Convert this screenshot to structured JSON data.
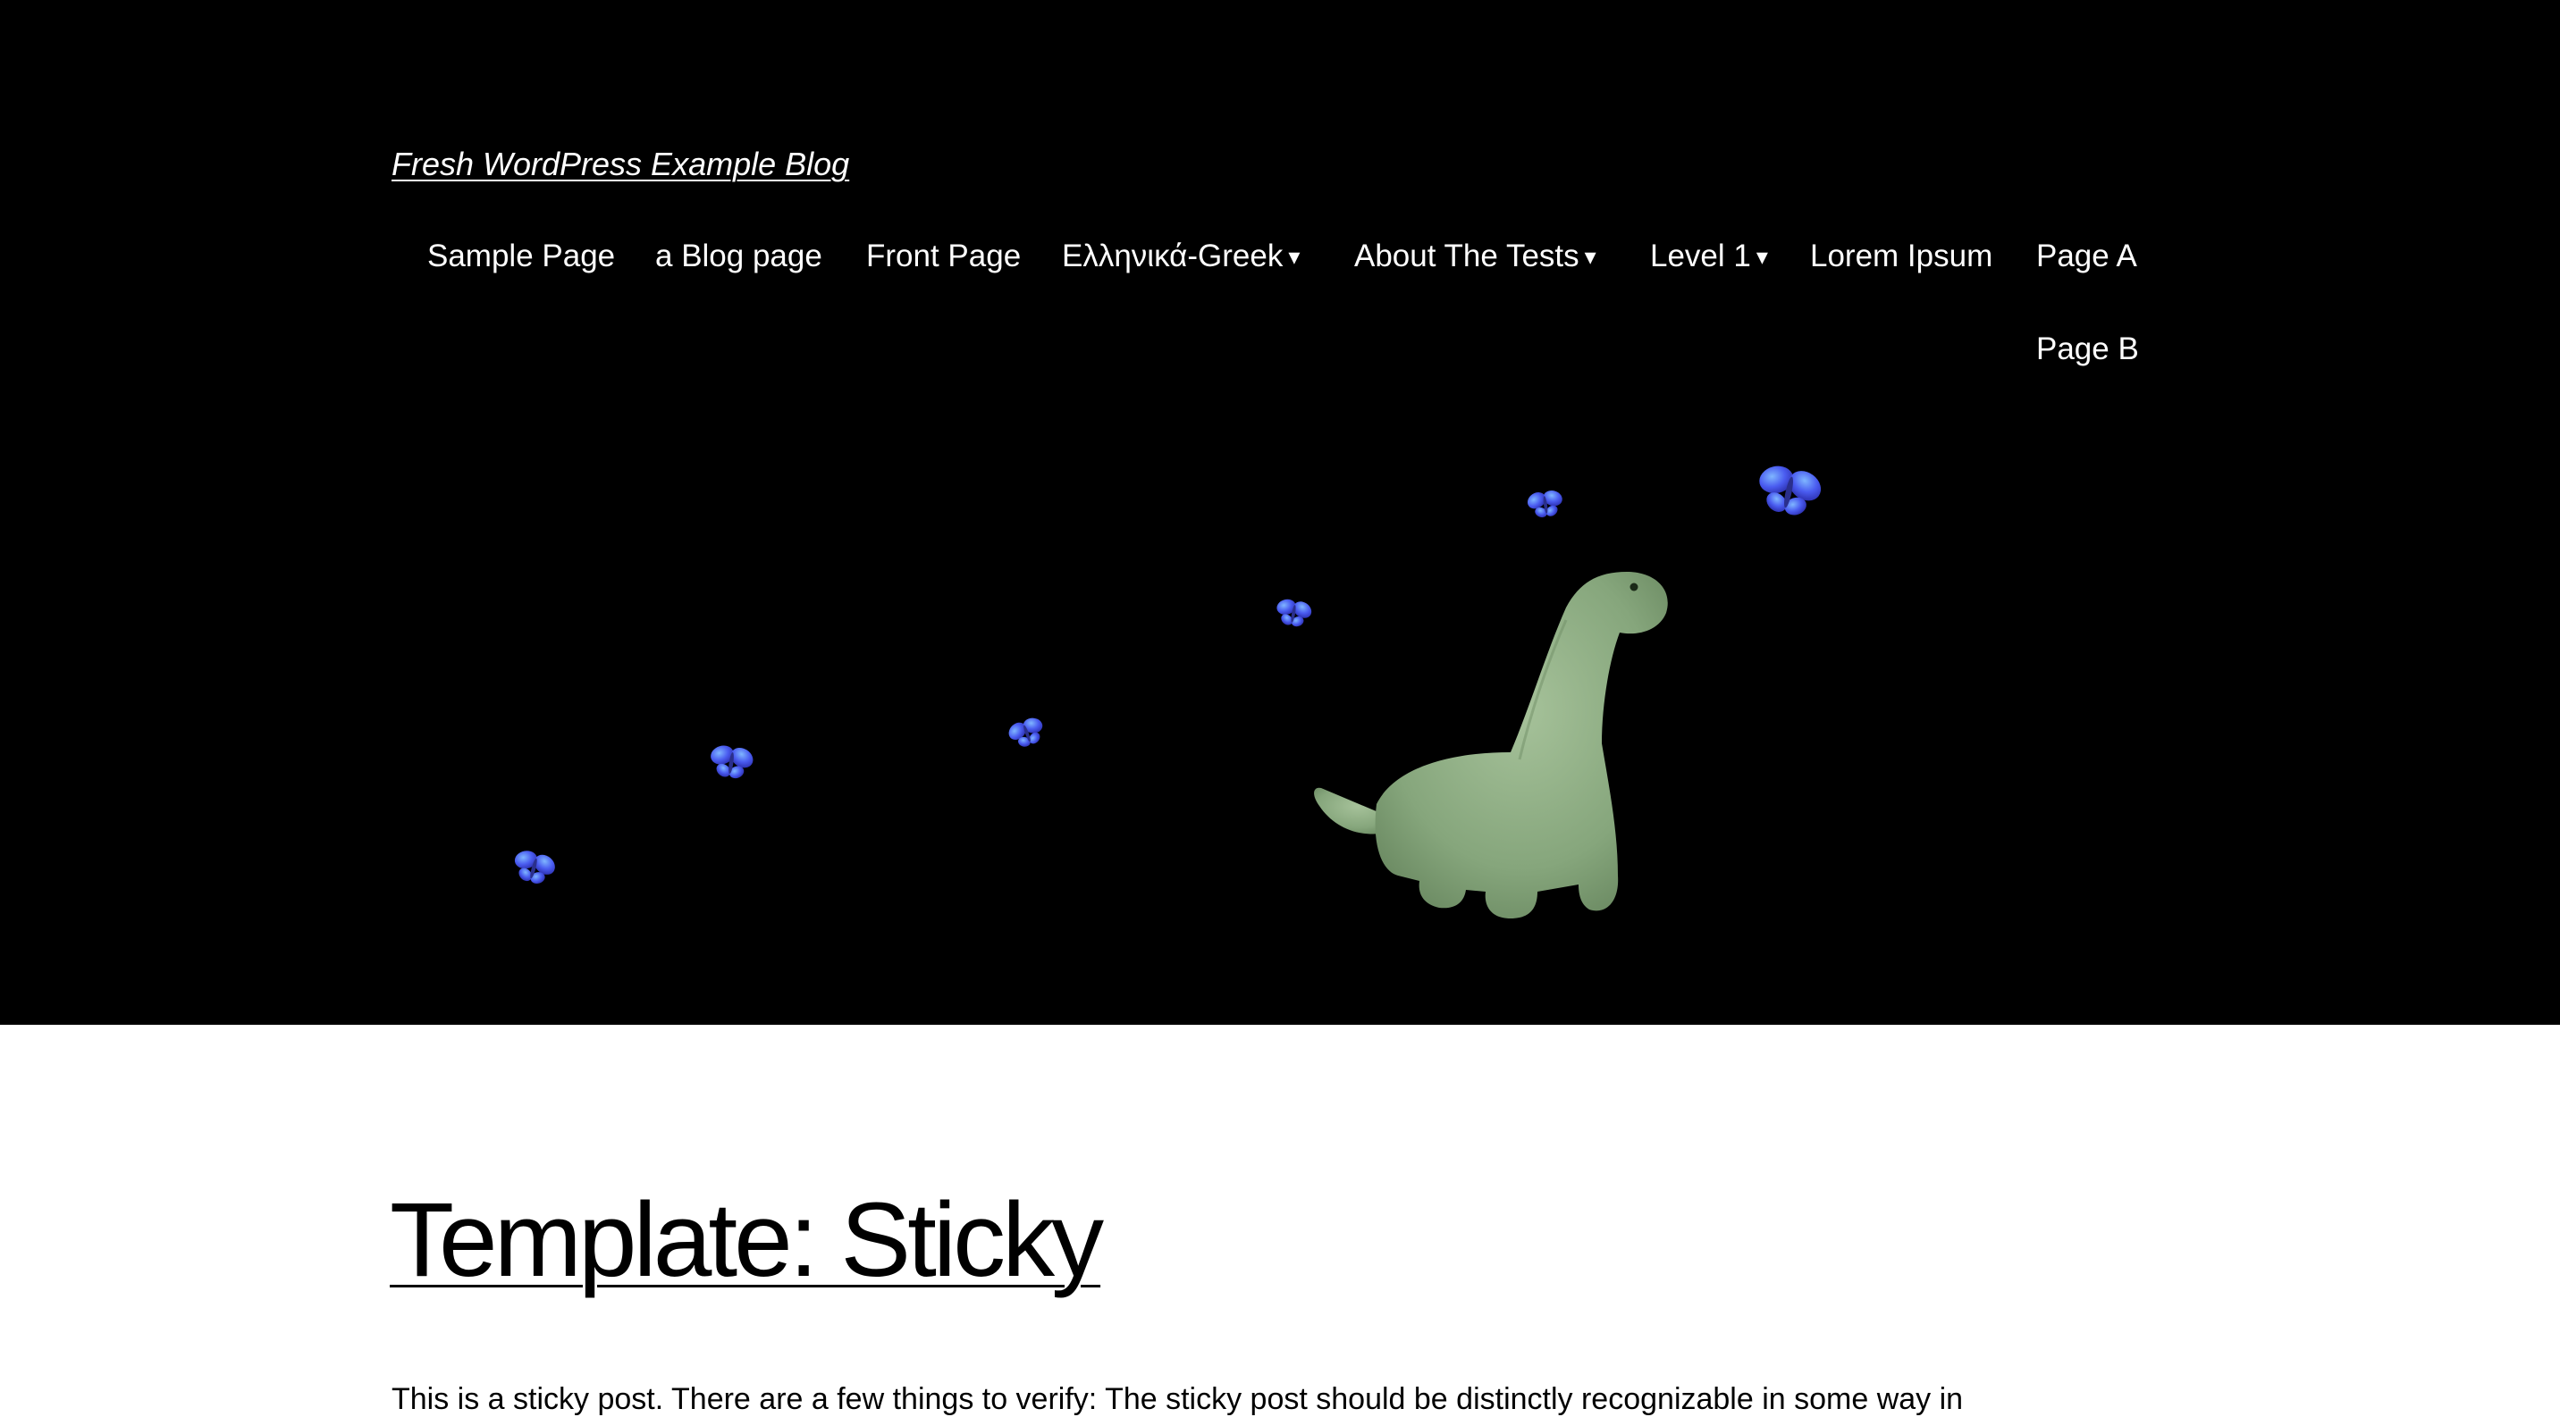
{
  "site": {
    "title": "Fresh WordPress Example Blog"
  },
  "nav": {
    "items": [
      {
        "label": "Sample Page",
        "has_submenu": false
      },
      {
        "label": "a Blog page",
        "has_submenu": false
      },
      {
        "label": "Front Page",
        "has_submenu": false
      },
      {
        "label": "Ελληνικά-Greek",
        "has_submenu": true
      },
      {
        "label": "About The Tests",
        "has_submenu": true
      },
      {
        "label": "Level 1",
        "has_submenu": true
      },
      {
        "label": "Lorem Ipsum",
        "has_submenu": false
      },
      {
        "label": "Page A",
        "has_submenu": false
      },
      {
        "label": "Page B",
        "has_submenu": false
      }
    ],
    "submenu_glyph": "▾"
  },
  "post": {
    "title": "Template: Sticky",
    "excerpt": "This is a sticky post. There are a few things to verify: The sticky post should be distinctly recognizable in some way in"
  },
  "colors": {
    "header_bg": "#000000",
    "header_text": "#ffffff",
    "content_bg": "#ffffff",
    "content_text": "#000000",
    "dino": "#8fae84",
    "butterfly": "#4f5be0"
  },
  "icons": {
    "hero_dinosaur": "dinosaur-illustration",
    "hero_butterflies": "butterfly-icon"
  }
}
